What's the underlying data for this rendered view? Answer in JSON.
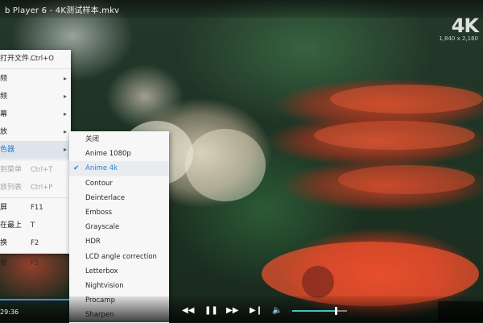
{
  "window": {
    "title": "b Player 6 - 4K测试样本.mkv"
  },
  "video": {
    "badge": "4K",
    "resolution": "1,840 x 2,160"
  },
  "context_menu": {
    "items": [
      {
        "label": "打开文件...",
        "shortcut": "Ctrl+O",
        "has_submenu": false,
        "disabled": false
      },
      {
        "label": "频",
        "shortcut": "",
        "has_submenu": true,
        "disabled": false
      },
      {
        "label": "频",
        "shortcut": "",
        "has_submenu": true,
        "disabled": false
      },
      {
        "label": "幕",
        "shortcut": "",
        "has_submenu": true,
        "disabled": false
      },
      {
        "label": "放",
        "shortcut": "",
        "has_submenu": true,
        "disabled": false
      },
      {
        "label": "色器",
        "shortcut": "",
        "has_submenu": true,
        "disabled": false,
        "active": true
      },
      {
        "label": "到菜单",
        "shortcut": "Ctrl+T",
        "has_submenu": false,
        "disabled": true
      },
      {
        "label": "放列表",
        "shortcut": "Ctrl+P",
        "has_submenu": false,
        "disabled": true
      },
      {
        "label": "屏",
        "shortcut": "F11",
        "has_submenu": false,
        "disabled": false
      },
      {
        "label": "在最上",
        "shortcut": "T",
        "has_submenu": false,
        "disabled": false
      },
      {
        "label": "换",
        "shortcut": "F2",
        "has_submenu": false,
        "disabled": false
      },
      {
        "label": "置",
        "shortcut": "F5",
        "has_submenu": false,
        "disabled": false
      }
    ]
  },
  "shader_submenu": {
    "items": [
      {
        "label": "关闭",
        "checked": false
      },
      {
        "label": "Anime 1080p",
        "checked": false
      },
      {
        "label": "Anime 4k",
        "checked": true
      },
      {
        "label": "Contour",
        "checked": false
      },
      {
        "label": "Deinterlace",
        "checked": false
      },
      {
        "label": "Emboss",
        "checked": false
      },
      {
        "label": "Grayscale",
        "checked": false
      },
      {
        "label": "HDR",
        "checked": false
      },
      {
        "label": "LCD angle correction",
        "checked": false
      },
      {
        "label": "Letterbox",
        "checked": false
      },
      {
        "label": "Nightvision",
        "checked": false
      },
      {
        "label": "Procamp",
        "checked": false
      },
      {
        "label": "Sharpen",
        "checked": false
      }
    ]
  },
  "controls": {
    "time": "29:36",
    "progress": 0.14,
    "volume": 0.8,
    "icons": [
      "rewind-icon",
      "pause-icon",
      "fast-forward-icon",
      "next-icon",
      "volume-icon"
    ],
    "accent_color": "#3a8ee6"
  }
}
